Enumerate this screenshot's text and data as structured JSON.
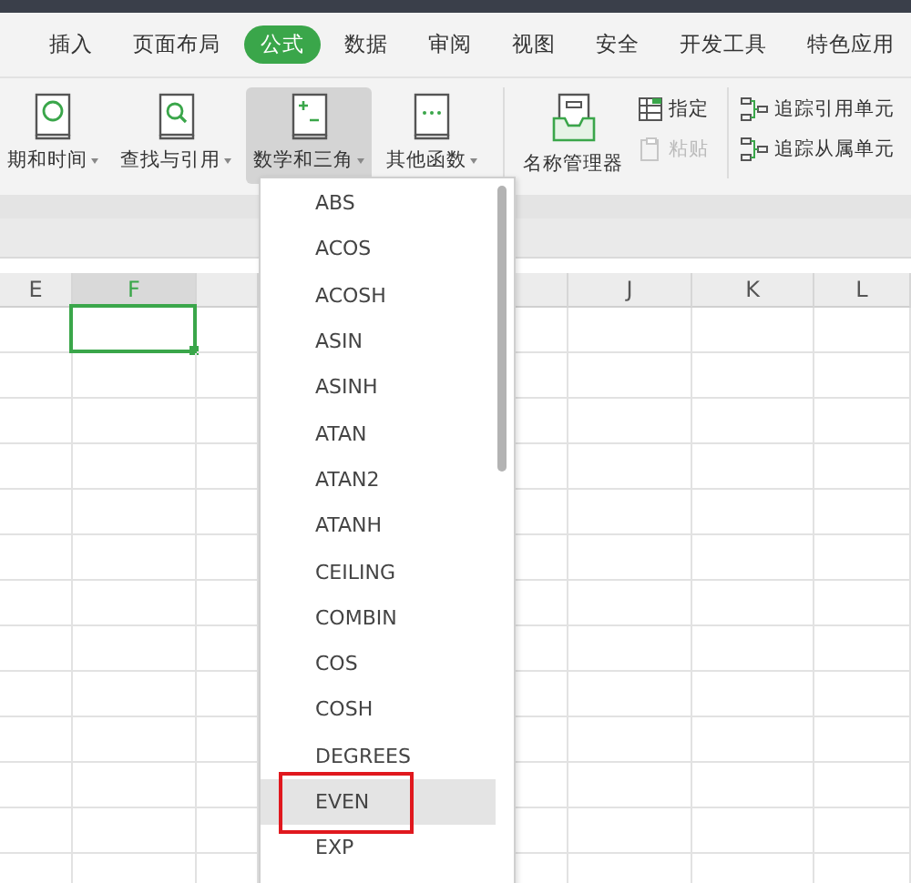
{
  "tabs": [
    {
      "label": "插入",
      "selected": false
    },
    {
      "label": "页面布局",
      "selected": false
    },
    {
      "label": "公式",
      "selected": true
    },
    {
      "label": "数据",
      "selected": false
    },
    {
      "label": "审阅",
      "selected": false
    },
    {
      "label": "视图",
      "selected": false
    },
    {
      "label": "安全",
      "selected": false
    },
    {
      "label": "开发工具",
      "selected": false
    },
    {
      "label": "特色应用",
      "selected": false
    }
  ],
  "ribbon": {
    "groups": [
      {
        "kind": "dropdown",
        "label": "期和时间",
        "pressed": false
      },
      {
        "kind": "dropdown",
        "label": "查找与引用",
        "pressed": false
      },
      {
        "kind": "dropdown",
        "label": "数学和三角",
        "pressed": true
      },
      {
        "kind": "dropdown",
        "label": "其他函数",
        "pressed": false
      },
      {
        "kind": "divider"
      },
      {
        "kind": "large",
        "label": "名称管理器",
        "pressed": false
      },
      {
        "kind": "stack",
        "items": [
          {
            "label": "指定",
            "disabled": false
          },
          {
            "label": "粘贴",
            "disabled": true
          }
        ]
      },
      {
        "kind": "divider"
      },
      {
        "kind": "stack",
        "items": [
          {
            "label": "追踪引用单元",
            "disabled": false
          },
          {
            "label": "追踪从属单元",
            "disabled": false
          }
        ]
      }
    ]
  },
  "sheet": {
    "columns": [
      {
        "label": "E",
        "selected": false
      },
      {
        "selected": true,
        "label": "F"
      },
      {
        "selected": false
      },
      {
        "selected": false
      },
      {
        "label": "J",
        "selected": false
      },
      {
        "label": "K",
        "selected": false
      },
      {
        "label": "L",
        "selected": false
      }
    ]
  },
  "menu": {
    "items": [
      {
        "label": "ABS",
        "selected": false,
        "outlined": false
      },
      {
        "label": "ACOS",
        "selected": false,
        "outlined": false
      },
      {
        "label": "ACOSH",
        "selected": false,
        "outlined": false
      },
      {
        "label": "ASIN",
        "selected": false,
        "outlined": false
      },
      {
        "label": "ASINH",
        "selected": false,
        "outlined": false
      },
      {
        "label": "ATAN",
        "selected": false,
        "outlined": false
      },
      {
        "label": "ATAN2",
        "selected": false,
        "outlined": false
      },
      {
        "label": "ATANH",
        "selected": false,
        "outlined": false
      },
      {
        "label": "CEILING",
        "selected": false,
        "outlined": false
      },
      {
        "label": "COMBIN",
        "selected": false,
        "outlined": false
      },
      {
        "label": "COS",
        "selected": false,
        "outlined": false
      },
      {
        "label": "COSH",
        "selected": false,
        "outlined": false
      },
      {
        "label": "DEGREES",
        "selected": false,
        "outlined": false
      },
      {
        "label": "EVEN",
        "selected": true,
        "outlined": true
      },
      {
        "label": "EXP",
        "selected": false,
        "outlined": false
      }
    ]
  }
}
